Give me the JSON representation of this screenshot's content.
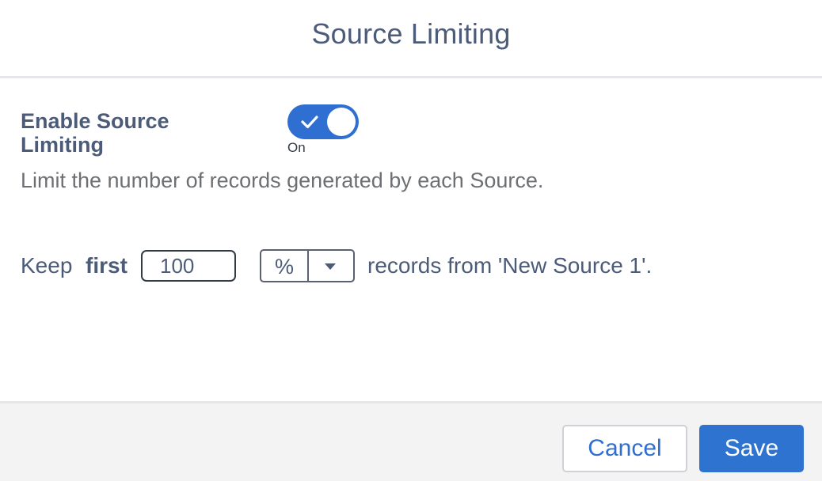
{
  "dialog": {
    "title": "Source Limiting"
  },
  "enable": {
    "label": "Enable Source Limiting",
    "toggle_on": true,
    "toggle_state_text": "On",
    "description": "Limit the number of records generated by each Source."
  },
  "limit_rule": {
    "keep_text": "Keep",
    "mode_text": "first",
    "count_value": "100",
    "unit_selected": "%",
    "suffix_text": "records from 'New Source 1'."
  },
  "footer": {
    "cancel_label": "Cancel",
    "save_label": "Save"
  },
  "colors": {
    "accent": "#2e6fd1",
    "text_primary": "#4b5b78",
    "text_muted": "#6d6f73",
    "footer_bg": "#f3f3f4"
  }
}
